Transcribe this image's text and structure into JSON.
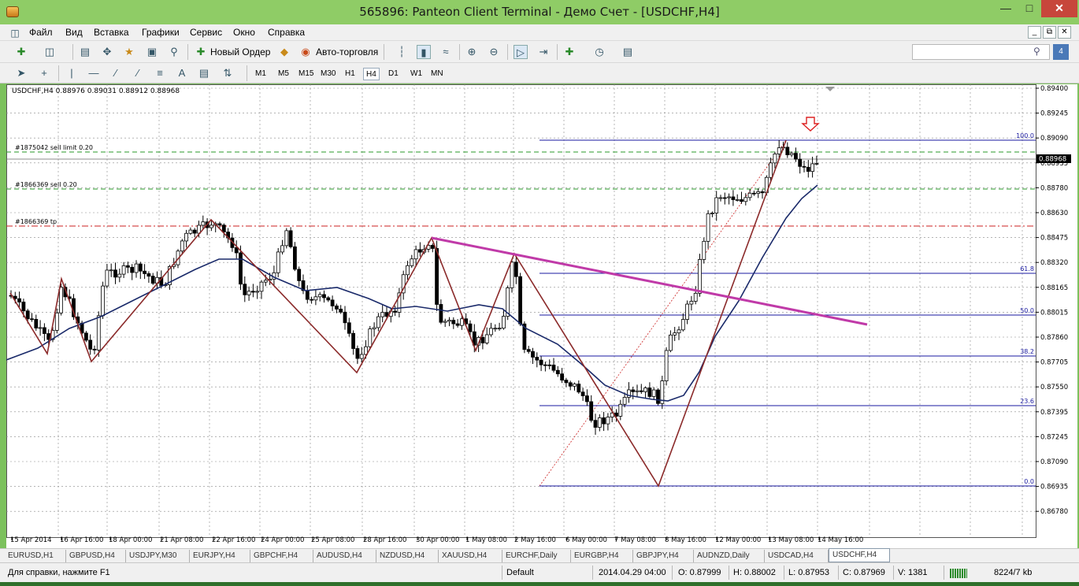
{
  "window": {
    "title": "565896: Panteon Client Terminal - Демо Счет - [USDCHF,H4]",
    "minimize_icon": "minimize-icon",
    "maximize_icon": "maximize-icon",
    "close_icon": "close-icon"
  },
  "menu": [
    "Файл",
    "Вид",
    "Вставка",
    "Графики",
    "Сервис",
    "Окно",
    "Справка"
  ],
  "toolbar": {
    "new_order": "Новый Ордер",
    "auto_trading": "Авто-торговля",
    "timeframes": [
      "M1",
      "M5",
      "M15",
      "M30",
      "H1",
      "H4",
      "D1",
      "W1",
      "MN"
    ],
    "active_timeframe": "H4",
    "text_tool": "A"
  },
  "chart": {
    "header": "USDCHF,H4  0.88976 0.89031 0.88912 0.88968",
    "orders": [
      "#1875042 sell limit 0.20",
      "#1866369 sell 0.20",
      "#1866369 tp"
    ],
    "price_axis": [
      "0.89400",
      "0.89245",
      "0.89090",
      "0.88935",
      "0.88780",
      "0.88630",
      "0.88475",
      "0.88320",
      "0.88165",
      "0.88015",
      "0.87860",
      "0.87705",
      "0.87550",
      "0.87395",
      "0.87245",
      "0.87090",
      "0.86935",
      "0.86780"
    ],
    "current_price": "0.88968",
    "fib_levels": [
      "100.0",
      "61.8",
      "50.0",
      "38.2",
      "23.6",
      "0.0"
    ],
    "time_axis": [
      "15 Apr 2014",
      "16 Apr 16:00",
      "18 Apr 00:00",
      "21 Apr 08:00",
      "22 Apr 16:00",
      "24 Apr 00:00",
      "25 Apr 08:00",
      "28 Apr 16:00",
      "30 Apr 00:00",
      "1 May 08:00",
      "2 May 16:00",
      "6 May 00:00",
      "7 May 08:00",
      "8 May 16:00",
      "12 May 00:00",
      "13 May 08:00",
      "14 May 16:00"
    ],
    "colors": {
      "bull": "#ffffff",
      "bear": "#000000",
      "ma": "#1a2a6a",
      "zigzag": "#8b2a2a",
      "trendline": "#c03aa8",
      "fib": "#1a1aa0",
      "order_green": "#2a9a2a",
      "order_red": "#cc2222",
      "arrow": "#dd2222"
    }
  },
  "tabs": [
    "EURUSD,H1",
    "GBPUSD,H4",
    "USDJPY,M30",
    "EURJPY,H4",
    "GBPCHF,H4",
    "AUDUSD,H4",
    "NZDUSD,H4",
    "XAUUSD,H4",
    "EURCHF,Daily",
    "EURGBP,H4",
    "GBPJPY,H4",
    "AUDNZD,Daily",
    "USDCAD,H4",
    "USDCHF,H4"
  ],
  "active_tab": "USDCHF,H4",
  "status": {
    "help": "Для справки, нажмите F1",
    "profile": "Default",
    "datetime": "2014.04.29 04:00",
    "open": "O: 0.87999",
    "high": "H: 0.88002",
    "low": "L: 0.87953",
    "close": "C: 0.87969",
    "volume": "V: 1381",
    "traffic": "8224/7 kb"
  }
}
